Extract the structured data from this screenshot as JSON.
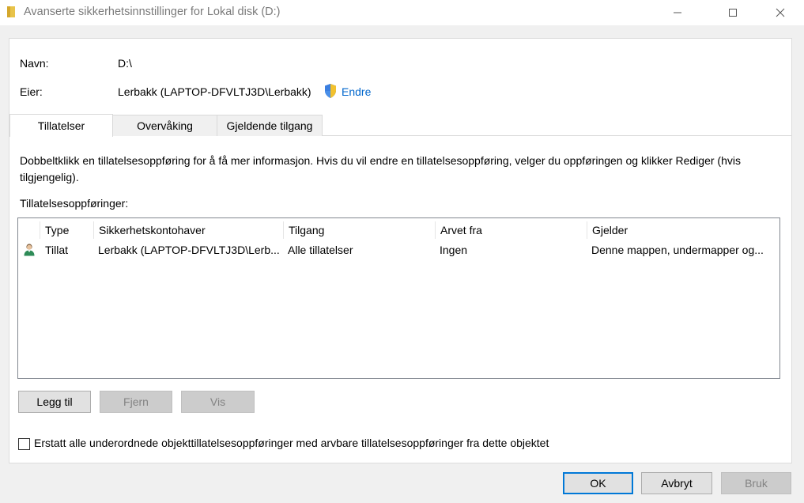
{
  "window": {
    "title": "Avanserte sikkerhetsinnstillinger for Lokal disk (D:)",
    "minimize_glyph": "—",
    "maximize_glyph": "☐",
    "close_glyph": "✕"
  },
  "info": {
    "name_label": "Navn:",
    "name_value": "D:\\",
    "owner_label": "Eier:",
    "owner_value": "Lerbakk (LAPTOP-DFVLTJ3D\\Lerbakk)",
    "change_link": "Endre"
  },
  "tabs": [
    {
      "label": "Tillatelser",
      "active": true
    },
    {
      "label": "Overvåking",
      "active": false
    },
    {
      "label": "Gjeldende tilgang",
      "active": false
    }
  ],
  "permissions": {
    "description": "Dobbeltklikk en tillatelsesoppføring for å få mer informasjon. Hvis du vil endre en tillatelsesoppføring, velger du oppføringen og klikker Rediger (hvis tilgjengelig).",
    "list_label": "Tillatelsesoppføringer:",
    "columns": [
      "Type",
      "Sikkerhetskontohaver",
      "Tilgang",
      "Arvet fra",
      "Gjelder"
    ],
    "rows": [
      {
        "icon": "user-icon",
        "type": "Tillat",
        "principal": "Lerbakk (LAPTOP-DFVLTJ3D\\Lerb...",
        "access": "Alle tillatelser",
        "inherited_from": "Ingen",
        "applies_to": "Denne mappen, undermapper og..."
      }
    ],
    "buttons": {
      "add": "Legg til",
      "remove": "Fjern",
      "view": "Vis"
    },
    "replace_checkbox_label": "Erstatt alle underordnede objekttillatelsesoppføringer med arvbare tillatelsesoppføringer fra dette objektet",
    "replace_checked": false
  },
  "footer": {
    "ok": "OK",
    "cancel": "Avbryt",
    "apply": "Bruk"
  },
  "colors": {
    "link": "#0066cc",
    "default_button_border": "#0078d7",
    "background": "#f0f0f0",
    "panel": "#ffffff"
  }
}
